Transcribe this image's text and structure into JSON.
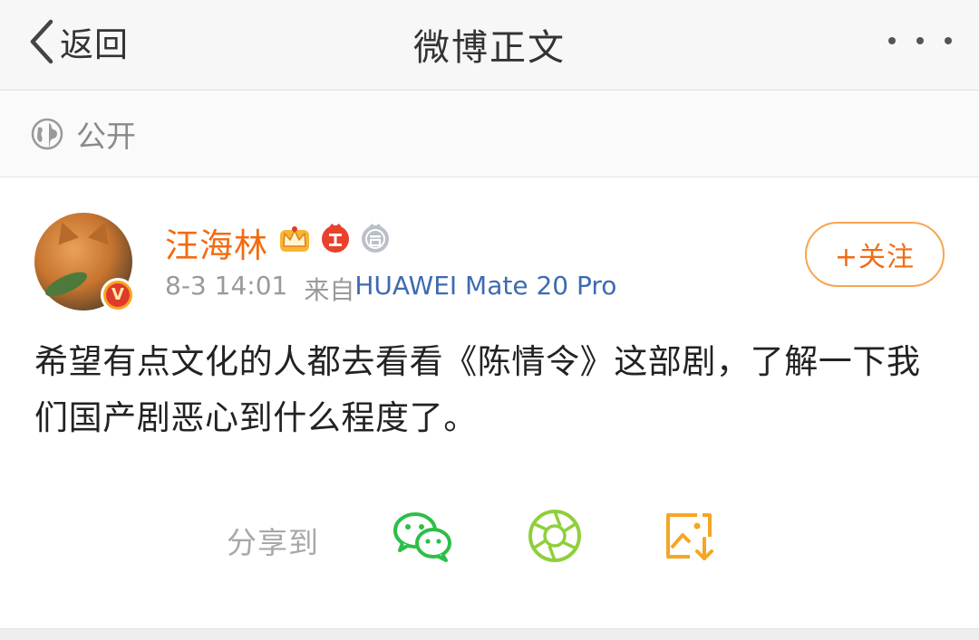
{
  "nav": {
    "back_label": "返回",
    "title": "微博正文"
  },
  "visibility": {
    "label": "公开"
  },
  "post": {
    "author": {
      "name": "汪海林",
      "verified_badge": "V",
      "badge_icons": [
        "crown-vip-icon",
        "red-fan-badge-icon",
        "answer-badge-icon"
      ]
    },
    "time": "8-3 14:01",
    "source_prefix": "来自",
    "source_device": "HUAWEI Mate 20 Pro",
    "follow_label": "+关注",
    "text": "希望有点文化的人都去看看《陈情令》这部剧，了解一下我们国产剧恶心到什么程度了。"
  },
  "share": {
    "label": "分享到",
    "targets": [
      "wechat-icon",
      "moments-icon",
      "save-image-icon"
    ]
  },
  "colors": {
    "accent_orange": "#f26b0f",
    "link_blue": "#3d6bb0",
    "wechat_green": "#2cbf48",
    "moments_green": "#8fcf3c",
    "save_orange": "#f5a623"
  }
}
